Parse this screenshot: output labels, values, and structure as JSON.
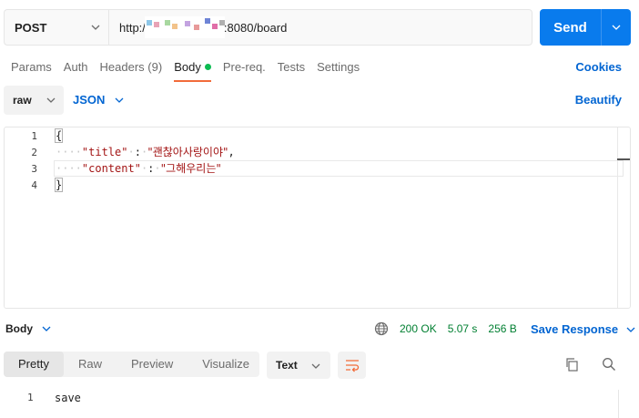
{
  "request": {
    "method": "POST",
    "url_prefix": "http:/",
    "url_suffix": ":8080/board",
    "send_label": "Send"
  },
  "tabs": [
    {
      "label": "Params"
    },
    {
      "label": "Auth"
    },
    {
      "label": "Headers (9)"
    },
    {
      "label": "Body"
    },
    {
      "label": "Pre-req."
    },
    {
      "label": "Tests"
    },
    {
      "label": "Settings"
    }
  ],
  "cookies_label": "Cookies",
  "body_options": {
    "mode": "raw",
    "language": "JSON",
    "beautify_label": "Beautify"
  },
  "editor": {
    "line_numbers": [
      "1",
      "2",
      "3",
      "4"
    ],
    "open_brace": "{",
    "close_brace": "}",
    "key1": "\"title\"",
    "val1": "\"괜찮아사랑이야\"",
    "key2": "\"content\"",
    "val2": "\"그해우리는\"",
    "colon": ":",
    "comma": ","
  },
  "response": {
    "body_label": "Body",
    "status": "200 OK",
    "time": "5.07 s",
    "size": "256 B",
    "save_label": "Save Response",
    "view_tabs": [
      "Pretty",
      "Raw",
      "Preview",
      "Visualize"
    ],
    "format": "Text",
    "line_number": "1",
    "content": "save"
  },
  "colors": {
    "accent": "#097bed",
    "link": "#0265d2",
    "active_tab_underline": "#f26b3a",
    "status_ok": "#007f31",
    "body_dot": "#0cbb52"
  }
}
